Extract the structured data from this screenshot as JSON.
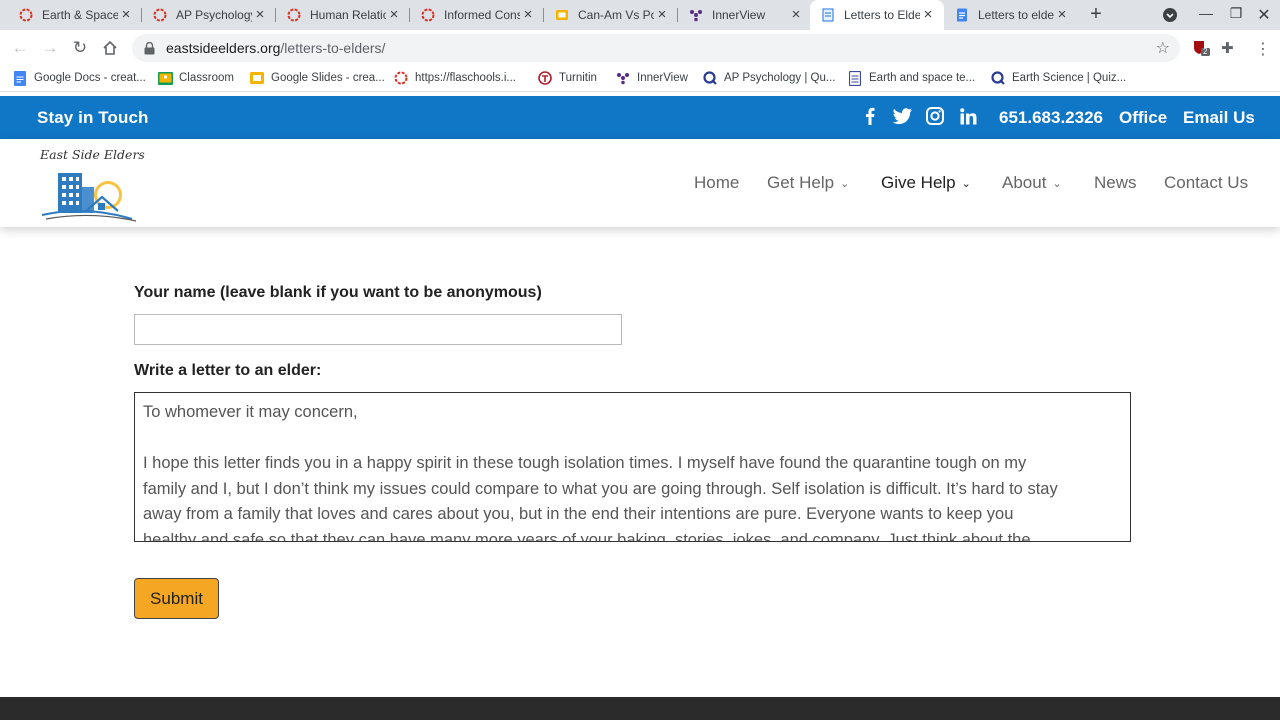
{
  "browser": {
    "tabs": [
      {
        "title": "Earth & Space",
        "icon": "ring-icon",
        "color": "#d93025"
      },
      {
        "title": "AP Psychology",
        "icon": "ring-icon",
        "color": "#d93025"
      },
      {
        "title": "Human Relatio",
        "icon": "ring-icon",
        "color": "#d93025"
      },
      {
        "title": "Informed Cons",
        "icon": "ring-icon",
        "color": "#d93025"
      },
      {
        "title": "Can-Am Vs Po",
        "icon": "slides-icon",
        "color": "#f4b400"
      },
      {
        "title": "InnerView",
        "icon": "innerview-icon",
        "color": "#5b2c83"
      },
      {
        "title": "Letters to Elde",
        "icon": "page-icon",
        "color": "#1a73e8"
      },
      {
        "title": "Letters to elder",
        "icon": "docs-icon",
        "color": "#4285f4"
      }
    ],
    "url_host": "eastsideelders.org",
    "url_path": "/letters-to-elders/",
    "extension_badge": "2",
    "bookmarks": [
      {
        "label": "Google Docs - creat...",
        "icon": "docs-icon"
      },
      {
        "label": "Classroom",
        "icon": "classroom-icon"
      },
      {
        "label": "Google Slides - crea...",
        "icon": "slides-icon"
      },
      {
        "label": "https://flaschools.i...",
        "icon": "ring-icon"
      },
      {
        "label": "Turnitin",
        "icon": "turnitin-icon"
      },
      {
        "label": "InnerView",
        "icon": "innerview-icon"
      },
      {
        "label": "AP Psychology | Qu...",
        "icon": "quizlet-icon"
      },
      {
        "label": "Earth and space te...",
        "icon": "doc-outline-icon"
      },
      {
        "label": "Earth Science | Quiz...",
        "icon": "quizlet-icon"
      }
    ]
  },
  "site": {
    "topbar": {
      "stay_in_touch": "Stay in Touch",
      "phone": "651.683.2326",
      "office": "Office",
      "email": "Email Us",
      "bg_color": "#1076c6"
    },
    "logo_text": "East Side Elders",
    "nav": [
      {
        "label": "Home",
        "dropdown": false,
        "active": false
      },
      {
        "label": "Get Help",
        "dropdown": true,
        "active": false
      },
      {
        "label": "Give Help",
        "dropdown": true,
        "active": true
      },
      {
        "label": "About",
        "dropdown": true,
        "active": false
      },
      {
        "label": "News",
        "dropdown": false,
        "active": false
      },
      {
        "label": "Contact Us",
        "dropdown": false,
        "active": false
      }
    ]
  },
  "form": {
    "name_label": "Your name (leave blank if you want to be anonymous)",
    "name_value": "",
    "letter_label": "Write a letter to an elder:",
    "letter_lines": [
      "To whomever it may concern,",
      "",
      "I hope this letter finds you in a happy spirit in these tough isolation times. I myself have found the quarantine tough on my",
      "family and I, but I don’t think my issues could compare to what you are going through. Self isolation is difficult. It’s hard to stay",
      "away from a family that loves and cares about you, but in the end their intentions are pure. Everyone wants to keep you",
      "healthy and safe so that they can have many more years of your baking, stories, jokes, and company. Just think about the"
    ],
    "submit_label": "Submit",
    "submit_color": "#f5a623"
  }
}
